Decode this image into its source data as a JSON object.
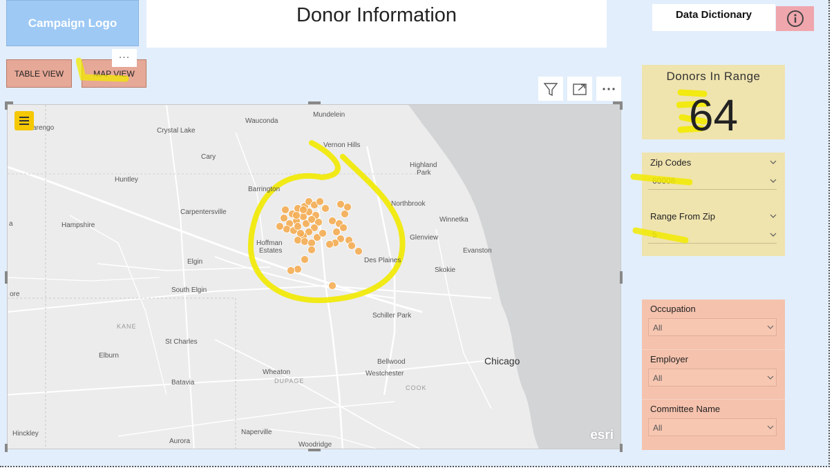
{
  "header": {
    "logo_label": "Campaign Logo",
    "title": "Donor Information",
    "data_dictionary_label": "Data Dictionary",
    "info_icon": "info-circle-icon"
  },
  "view_buttons": {
    "table_view": "TABLE VIEW",
    "map_view": "MAP VIEW",
    "more": "..."
  },
  "visual_toolbar": {
    "filter_icon": "filter-icon",
    "focus_icon": "focus-mode-icon",
    "more_icon": "more-options-icon"
  },
  "map": {
    "labels": {
      "marengo": "arengo",
      "crystal_lake": "Crystal Lake",
      "wauconda": "Wauconda",
      "mundelein": "Mundelein",
      "vernon_hills": "Vernon Hills",
      "cary": "Cary",
      "highland_park": "Highland",
      "highland_park_2": "Park",
      "huntley": "Huntley",
      "barrington": "Barrington",
      "northbrook": "Northbrook",
      "carpentersville": "Carpentersville",
      "hampshire": "Hampshire",
      "winnetka": "Winnetka",
      "hoffman": "Hoffman",
      "estates": "Estates",
      "glenview": "Glenview",
      "evanston": "Evanston",
      "elgin": "Elgin",
      "des_plaines": "Des Plaines",
      "skokie": "Skokie",
      "south_elgin": "South Elgin",
      "schiller_park": "Schiller Park",
      "kane": "KANE",
      "st_charles": "St Charles",
      "elburn": "Elburn",
      "chicago": "Chicago",
      "bellwood": "Bellwood",
      "wheaton": "Wheaton",
      "westchester": "Westchester",
      "dupage": "DUPAGE",
      "cook": "COOK",
      "batavia": "Batavia",
      "hinckley": "Hinckley",
      "naperville": "Naperville",
      "aurora": "Aurora",
      "woodridge": "Woodridge",
      "ore": "ore",
      "a": "a"
    },
    "attribution": "esri",
    "marker_color": "#f5a94a"
  },
  "kpi": {
    "title": "Donors In Range",
    "value": "64"
  },
  "filters_top": {
    "zip_label": "Zip Codes",
    "zip_value": "60008",
    "range_label": "Range From Zip",
    "range_value": "5"
  },
  "filters_bottom": {
    "occupation_label": "Occupation",
    "occupation_value": "All",
    "employer_label": "Employer",
    "employer_value": "All",
    "committee_label": "Committee Name",
    "committee_value": "All"
  },
  "colors": {
    "canvas": "#e2eefb",
    "button": "#e6a897",
    "kpi_card": "#efe3ae",
    "filter_card": "#f5c2ad",
    "highlight": "#f2ea00"
  }
}
